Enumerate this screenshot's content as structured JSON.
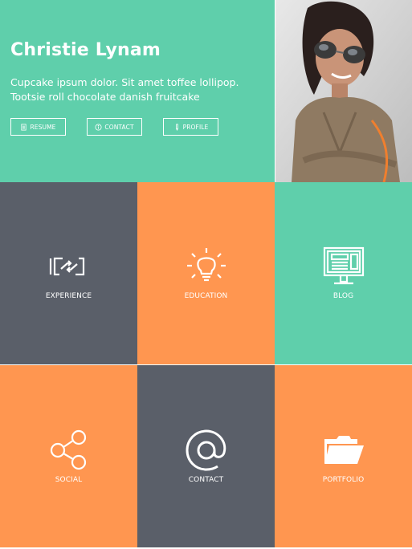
{
  "hero": {
    "name": "Christie Lynam",
    "bio_line1": "Cupcake ipsum dolor. Sit amet toffee lollipop.",
    "bio_line2": "Tootsie roll chocolate danish fruitcake",
    "buttons": [
      {
        "label": "RESUME",
        "icon": "document-icon"
      },
      {
        "label": "CONTACT",
        "icon": "info-icon"
      },
      {
        "label": "PROFILE",
        "icon": "pen-icon"
      }
    ]
  },
  "photo": {
    "alt": "portrait-photo"
  },
  "tiles": [
    {
      "label": "EXPERIENCE",
      "icon": "refresh-icon",
      "color": "#5a5f69"
    },
    {
      "label": "EDUCATION",
      "icon": "lightbulb-icon",
      "color": "#ff9650"
    },
    {
      "label": "BLOG",
      "icon": "monitor-icon",
      "color": "#5fcfab"
    },
    {
      "label": "SOCIAL",
      "icon": "share-icon",
      "color": "#ff9650"
    },
    {
      "label": "CONTACT",
      "icon": "at-sign-icon",
      "color": "#5a5f69"
    },
    {
      "label": "PORTFOLIO",
      "icon": "folder-icon",
      "color": "#ff9650"
    }
  ],
  "colors": {
    "green": "#5fcfab",
    "orange": "#ff9650",
    "dark": "#5a5f69"
  }
}
